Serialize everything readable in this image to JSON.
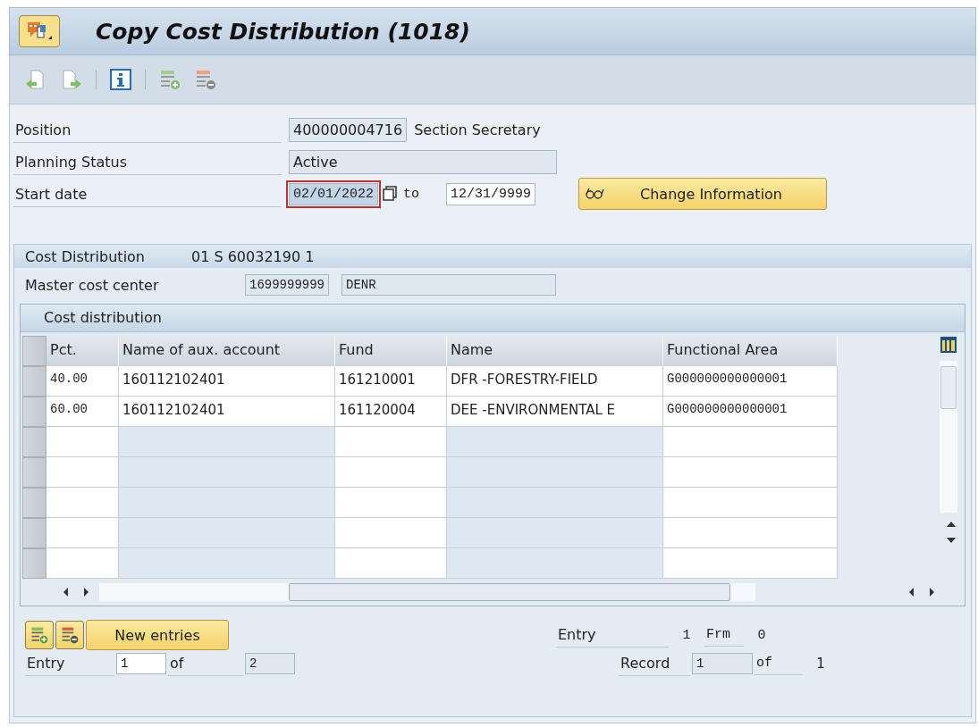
{
  "window": {
    "title": "Copy Cost Distribution (1018)"
  },
  "header": {
    "position": {
      "label": "Position",
      "value": "400000004716",
      "text": "Section Secretary"
    },
    "planning_status": {
      "label": "Planning Status",
      "value": "Active"
    },
    "start_date": {
      "label": "Start date",
      "value": "02/01/2022",
      "selected": true,
      "to_label": "to",
      "end_value": "12/31/9999"
    },
    "change_button": "Change Information"
  },
  "cost_distribution": {
    "title": "Cost Distribution",
    "code": "01 S  60032190 1",
    "master_cost_center": {
      "label": "Master cost center",
      "value": "1699999999",
      "name": "DENR"
    },
    "table": {
      "title": "Cost distribution",
      "columns": [
        "Pct.",
        "Name of aux. account",
        "Fund",
        "Name",
        "Functional Area"
      ],
      "rows": [
        {
          "cells": [
            "40.00",
            "160112102401",
            "161210001",
            "DFR -FORESTRY-FIELD",
            "G000000000000001"
          ]
        },
        {
          "cells": [
            "60.00",
            "160112102401",
            "161120004",
            "DEE -ENVIRONMENTAL E",
            "G000000000000001"
          ]
        }
      ]
    },
    "new_entries_button": "New entries",
    "entry": {
      "label": "Entry",
      "value": "1",
      "of_label": "of",
      "total": "2"
    },
    "status": {
      "entry_label": "Entry",
      "entry_value": "1",
      "frm_label": "Frm",
      "frm_value": "0",
      "record_label": "Record",
      "record_value": "1",
      "of_label": "of",
      "record_total": "1"
    }
  }
}
